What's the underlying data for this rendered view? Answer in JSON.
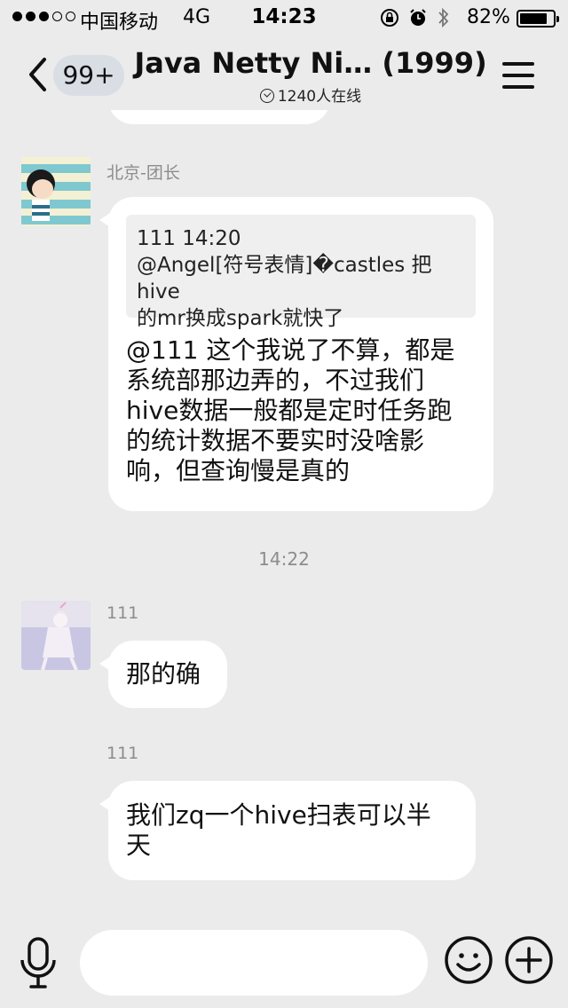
{
  "status_bar": {
    "carrier": "中国移动",
    "network": "4G",
    "time": "14:23",
    "battery_text": "82%",
    "battery_level": 0.82
  },
  "nav": {
    "unread_badge": "99+",
    "title": "Java Netty Ni… (1999)",
    "online_text": "1240人在线"
  },
  "messages": [
    {
      "sender": "北京-团长",
      "quote_line1": "111 14:20",
      "quote_line2": "@Angel[符号表情]�castles 把hive",
      "quote_line3": "的mr换成spark就快了",
      "text_line1": "@111 这个我说了不算，都是",
      "text_line2": "系统部那边弄的，不过我们",
      "text_line3": "hive数据一般都是定时任务跑",
      "text_line4": "的统计数据不要实时没啥影",
      "text_line5": "响，但查询慢是真的"
    },
    {
      "timestamp": "14:22"
    },
    {
      "sender": "111",
      "text_line1": "那的确"
    },
    {
      "sender": "111",
      "text_line1": "我们zq一个hive扫表可以半",
      "text_line2": "天"
    }
  ],
  "input": {
    "value": "",
    "placeholder": ""
  },
  "colors": {
    "background": "#ebebeb",
    "bubble": "#ffffff",
    "meta_text": "#8c8c8c"
  }
}
